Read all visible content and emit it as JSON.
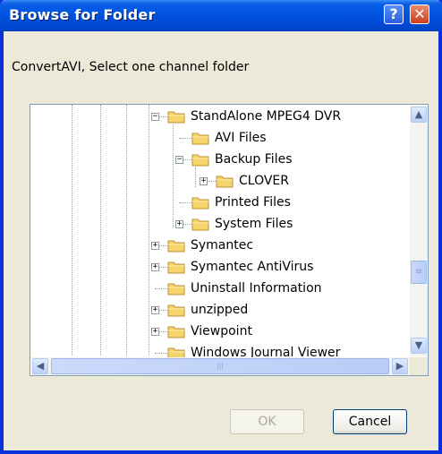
{
  "window": {
    "title": "Browse for Folder",
    "help_glyph": "?",
    "close_glyph": "✕"
  },
  "prompt": "ConvertAVI, Select one channel folder",
  "tree": {
    "items": [
      {
        "label": "StandAlone MPEG4 DVR",
        "expander": "−"
      },
      {
        "label": "AVI Files",
        "expander": ""
      },
      {
        "label": "Backup Files",
        "expander": "−"
      },
      {
        "label": "CLOVER",
        "expander": "+"
      },
      {
        "label": "Printed Files",
        "expander": ""
      },
      {
        "label": "System Files",
        "expander": "+"
      },
      {
        "label": "Symantec",
        "expander": "+"
      },
      {
        "label": "Symantec AntiVirus",
        "expander": "+"
      },
      {
        "label": "Uninstall Information",
        "expander": ""
      },
      {
        "label": "unzipped",
        "expander": "+"
      },
      {
        "label": "Viewpoint",
        "expander": "+"
      },
      {
        "label": "Windows Journal Viewer",
        "expander": ""
      }
    ]
  },
  "scrollbars": {
    "up_arrow": "▲",
    "down_arrow": "▼",
    "left_arrow": "◀",
    "right_arrow": "▶",
    "vertical_thumb_grip": "≡",
    "horizontal_thumb_grip": "|||"
  },
  "buttons": {
    "ok_label": "OK",
    "cancel_label": "Cancel"
  },
  "colors": {
    "titlebar": "#0054e3",
    "folder": "#f5d56b"
  }
}
